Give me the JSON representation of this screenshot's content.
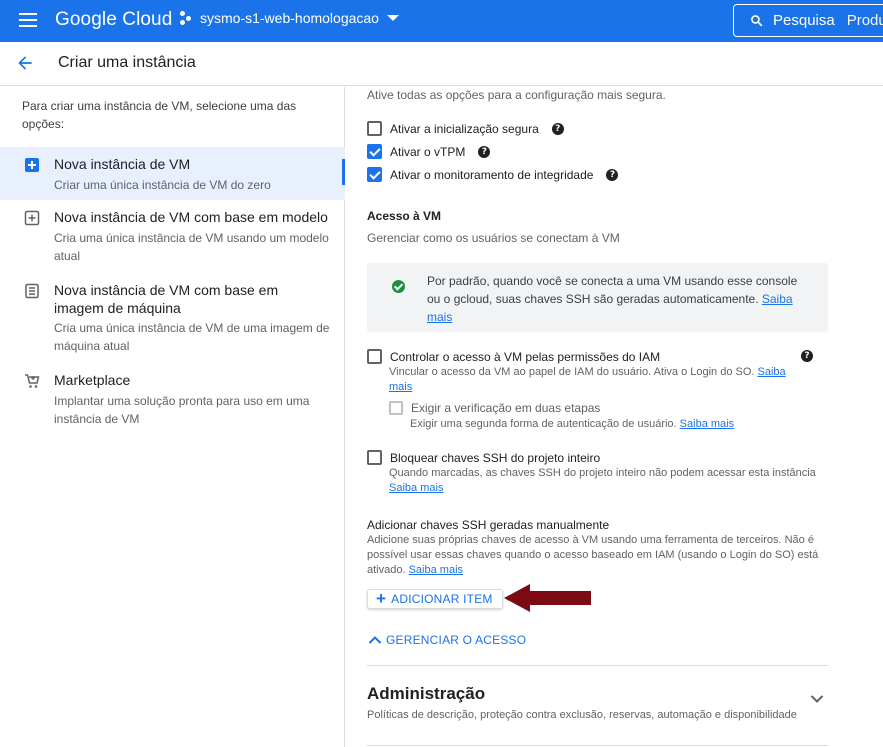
{
  "topbar": {
    "logo": "Google Cloud",
    "project": "sysmo-s1-web-homologacao",
    "search_label": "Pesquisa",
    "search_hint": "Produ"
  },
  "header": {
    "title": "Criar uma instância"
  },
  "left": {
    "intro": "Para criar uma instância de VM, selecione uma das opções:",
    "options": [
      {
        "title": "Nova instância de VM",
        "desc": "Criar uma única instância de VM do zero",
        "icon": "add-box-icon"
      },
      {
        "title": "Nova instância de VM com base em modelo",
        "desc": "Cria uma única instância de VM usando um modelo atual",
        "icon": "template-icon"
      },
      {
        "title": "Nova instância de VM com base em imagem de máquina",
        "desc": "Cria uma única instância de VM de uma imagem de máquina atual",
        "icon": "machine-image-icon"
      },
      {
        "title": "Marketplace",
        "desc": "Implantar uma solução pronta para uso em uma instância de VM",
        "icon": "cart-icon"
      }
    ]
  },
  "right": {
    "top_note": "Ative todas as opções para a configuração mais segura.",
    "secure_boot": "Ativar a inicialização segura",
    "vtpm": "Ativar o vTPM",
    "integrity": "Ativar o monitoramento de integridade",
    "access_title": "Acesso à VM",
    "access_desc": "Gerenciar como os usuários se conectam à VM",
    "info_msg": "Por padrão, quando você se conecta a uma VM usando esse console ou o gcloud, suas chaves SSH são geradas automaticamente.",
    "saiba_mais": "Saiba mais",
    "iam_label": "Controlar o acesso à VM pelas permissões do IAM",
    "iam_desc": "Vincular o acesso da VM ao papel de IAM do usuário. Ativa o Login do SO.",
    "twofa_label": "Exigir a verificação em duas etapas",
    "twofa_desc": "Exigir uma segunda forma de autenticação de usuário.",
    "block_label": "Bloquear chaves SSH do projeto inteiro",
    "block_desc": "Quando marcadas, as chaves SSH do projeto inteiro não podem acessar esta instância",
    "manual_title": "Adicionar chaves SSH geradas manualmente",
    "manual_desc": "Adicione suas próprias chaves de acesso à VM usando uma ferramenta de terceiros. Não é possível usar essas chaves quando o acesso baseado em IAM (usando o Login do SO) está ativado.",
    "add_item": "ADICIONAR ITEM",
    "manage": "GERENCIAR O ACESSO",
    "admin_title": "Administração",
    "admin_desc": "Políticas de descrição, proteção contra exclusão, reservas, automação e disponibilidade",
    "checked": {
      "secure_boot": false,
      "vtpm": true,
      "integrity": true,
      "iam": false,
      "twofa": false,
      "block": false
    }
  },
  "colors": {
    "brand": "#1a73e8",
    "annotation_arrow": "#7b0a14",
    "success": "#1e8e3e"
  }
}
